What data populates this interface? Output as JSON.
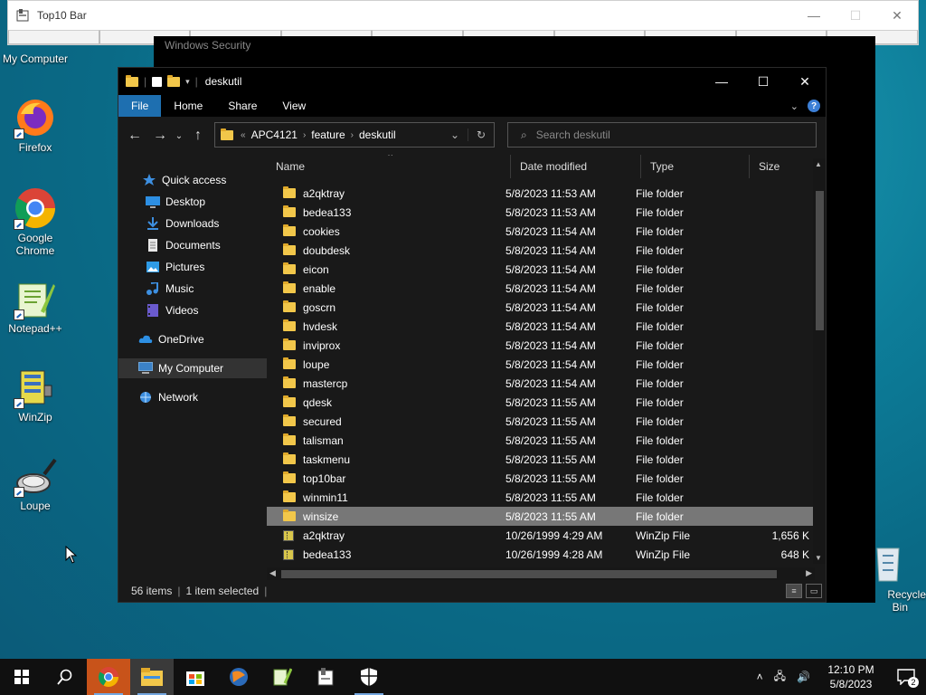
{
  "top10bar": {
    "title": "Top10 Bar",
    "min": "—",
    "max": "☐",
    "close": "✕"
  },
  "security_window": {
    "title": "Windows Security"
  },
  "desktop_icons": [
    {
      "label": "My Computer"
    },
    {
      "label": "Firefox"
    },
    {
      "label": "Google Chrome"
    },
    {
      "label": "Notepad++"
    },
    {
      "label": "WinZip"
    },
    {
      "label": "Loupe"
    },
    {
      "label": "Recycle Bin"
    }
  ],
  "explorer": {
    "title": "deskutil",
    "ribbon_tabs": [
      "File",
      "Home",
      "Share",
      "View"
    ],
    "help": "?",
    "address": {
      "prefix": "«",
      "crumbs": [
        "APC4121",
        "feature",
        "deskutil"
      ]
    },
    "search_placeholder": "Search deskutil",
    "nav": [
      {
        "label": "Quick access"
      },
      {
        "label": "Desktop"
      },
      {
        "label": "Downloads"
      },
      {
        "label": "Documents"
      },
      {
        "label": "Pictures"
      },
      {
        "label": "Music"
      },
      {
        "label": "Videos"
      },
      {
        "label": "OneDrive"
      },
      {
        "label": "My Computer"
      },
      {
        "label": "Network"
      }
    ],
    "columns": [
      "Name",
      "Date modified",
      "Type",
      "Size"
    ],
    "rows": [
      {
        "name": "a2qktray",
        "date": "5/8/2023 11:53 AM",
        "type": "File folder",
        "size": ""
      },
      {
        "name": "bedea133",
        "date": "5/8/2023 11:53 AM",
        "type": "File folder",
        "size": ""
      },
      {
        "name": "cookies",
        "date": "5/8/2023 11:54 AM",
        "type": "File folder",
        "size": ""
      },
      {
        "name": "doubdesk",
        "date": "5/8/2023 11:54 AM",
        "type": "File folder",
        "size": ""
      },
      {
        "name": "eicon",
        "date": "5/8/2023 11:54 AM",
        "type": "File folder",
        "size": ""
      },
      {
        "name": "enable",
        "date": "5/8/2023 11:54 AM",
        "type": "File folder",
        "size": ""
      },
      {
        "name": "goscrn",
        "date": "5/8/2023 11:54 AM",
        "type": "File folder",
        "size": ""
      },
      {
        "name": "hvdesk",
        "date": "5/8/2023 11:54 AM",
        "type": "File folder",
        "size": ""
      },
      {
        "name": "inviprox",
        "date": "5/8/2023 11:54 AM",
        "type": "File folder",
        "size": ""
      },
      {
        "name": "loupe",
        "date": "5/8/2023 11:54 AM",
        "type": "File folder",
        "size": ""
      },
      {
        "name": "mastercp",
        "date": "5/8/2023 11:54 AM",
        "type": "File folder",
        "size": ""
      },
      {
        "name": "qdesk",
        "date": "5/8/2023 11:55 AM",
        "type": "File folder",
        "size": ""
      },
      {
        "name": "secured",
        "date": "5/8/2023 11:55 AM",
        "type": "File folder",
        "size": ""
      },
      {
        "name": "talisman",
        "date": "5/8/2023 11:55 AM",
        "type": "File folder",
        "size": ""
      },
      {
        "name": "taskmenu",
        "date": "5/8/2023 11:55 AM",
        "type": "File folder",
        "size": ""
      },
      {
        "name": "top10bar",
        "date": "5/8/2023 11:55 AM",
        "type": "File folder",
        "size": ""
      },
      {
        "name": "winmin11",
        "date": "5/8/2023 11:55 AM",
        "type": "File folder",
        "size": ""
      },
      {
        "name": "winsize",
        "date": "5/8/2023 11:55 AM",
        "type": "File folder",
        "size": ""
      },
      {
        "name": "a2qktray",
        "date": "10/26/1999 4:29 AM",
        "type": "WinZip File",
        "size": "1,656 K"
      },
      {
        "name": "bedea133",
        "date": "10/26/1999 4:28 AM",
        "type": "WinZip File",
        "size": "648 K"
      }
    ],
    "status": {
      "count": "56 items",
      "selected": "1 item selected"
    }
  },
  "taskbar": {
    "time": "12:10 PM",
    "date": "5/8/2023",
    "notifications": "2"
  }
}
